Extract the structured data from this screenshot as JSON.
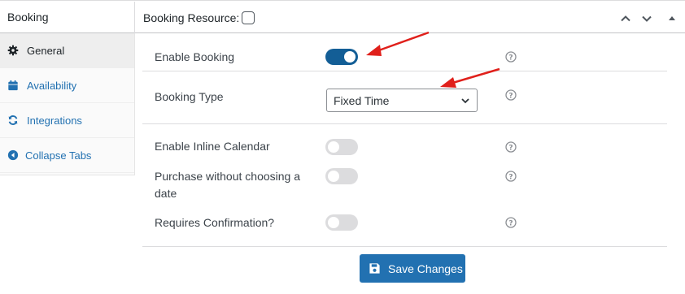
{
  "header": {
    "title": "Booking",
    "resource_label": "Booking Resource:",
    "resource_checked": false,
    "controls": [
      "chevron-up-icon",
      "chevron-down-icon",
      "caret-up-icon"
    ]
  },
  "sidebar": {
    "tabs": [
      {
        "label": "General",
        "icon": "gear-icon",
        "active": true
      },
      {
        "label": "Availability",
        "icon": "calendar-icon",
        "active": false
      },
      {
        "label": "Integrations",
        "icon": "sync-icon",
        "active": false
      },
      {
        "label": "Collapse Tabs",
        "icon": "collapse-icon",
        "active": false
      }
    ]
  },
  "form": {
    "enable_booking": {
      "label": "Enable Booking",
      "on": true
    },
    "booking_type": {
      "label": "Booking Type",
      "value": "Fixed Time"
    },
    "inline_calendar": {
      "label": "Enable Inline Calendar",
      "on": false
    },
    "purchase_without_date": {
      "label_line1": "Purchase without choosing a",
      "label_line2": "date",
      "on": false
    },
    "requires_confirmation": {
      "label": "Requires Confirmation?",
      "on": false
    }
  },
  "save_button": {
    "label": "Save Changes"
  },
  "colors": {
    "accent": "#2271b1",
    "toggle_on": "#135e96",
    "toggle_off": "#dcdcde",
    "annotation_arrow": "#e0201b"
  }
}
